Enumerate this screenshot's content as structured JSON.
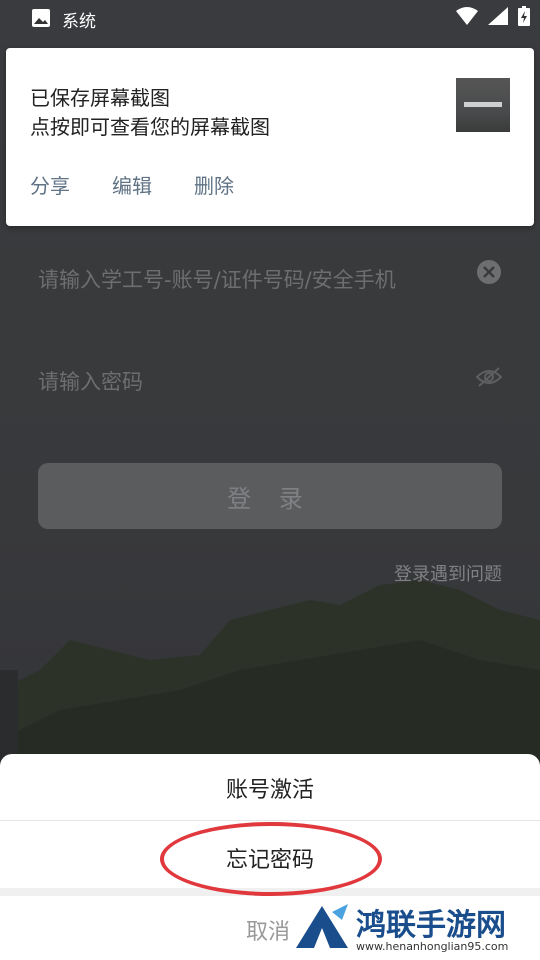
{
  "status_bar": {
    "app_label": "系统"
  },
  "notification": {
    "line1": "已保存屏幕截图",
    "line2": "点按即可查看您的屏幕截图",
    "actions": [
      "分享",
      "编辑",
      "删除"
    ]
  },
  "login": {
    "account_placeholder": "请输入学工号-账号/证件号码/安全手机",
    "password_placeholder": "请输入密码",
    "login_button": "登 录",
    "problem_link": "登录遇到问题"
  },
  "sheet": {
    "options": [
      "账号激活",
      "忘记密码"
    ],
    "cancel": "取消"
  },
  "watermark": {
    "brand": "鸿联手游网",
    "url": "www.henanhonglian95.com"
  },
  "colors": {
    "accent_red": "#e0383c",
    "link_blue_gray": "#5f7385",
    "brand_blue": "#1a4d8c"
  }
}
